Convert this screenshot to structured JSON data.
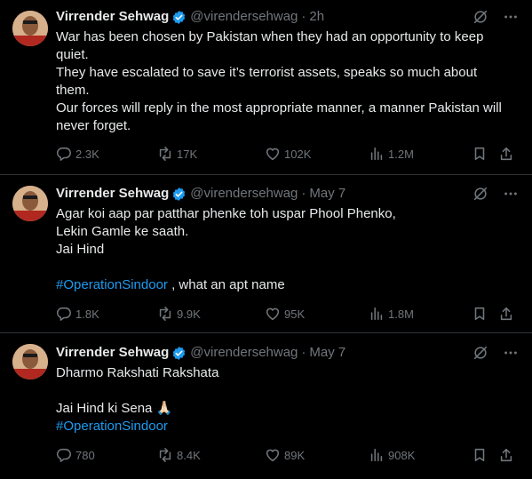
{
  "tweets": [
    {
      "author": "Virrender Sehwag",
      "handle": "@virendersehwag",
      "time": "2h",
      "lines": [
        "War has been chosen by Pakistan when they had an opportunity to keep",
        "quiet.",
        "They have escalated to save it’s terrorist assets, speaks so much about",
        "them.",
        "Our forces will reply in the most appropriate manner, a manner Pakistan will",
        "never forget."
      ],
      "replies": "2.3K",
      "reposts": "17K",
      "likes": "102K",
      "views": "1.2M"
    },
    {
      "author": "Virrender Sehwag",
      "handle": "@virendersehwag",
      "time": "May 7",
      "lines": [
        "Agar koi aap par patthar phenke toh uspar Phool Phenko,",
        "Lekin Gamle ke saath.",
        "Jai Hind",
        ""
      ],
      "hashtag": "#OperationSindoor",
      "hashtag_suffix": " , what an apt name",
      "replies": "1.8K",
      "reposts": "9.9K",
      "likes": "95K",
      "views": "1.8M"
    },
    {
      "author": "Virrender Sehwag",
      "handle": "@virendersehwag",
      "time": "May 7",
      "lines": [
        "Dharmo Rakshati Rakshata",
        "",
        "Jai Hind ki Sena 🙏🏻"
      ],
      "hashtag": "#OperationSindoor",
      "replies": "780",
      "reposts": "8.4K",
      "likes": "89K",
      "views": "908K"
    }
  ],
  "colors": {
    "background": "#000000",
    "text": "#e7e9ea",
    "muted": "#71767b",
    "link": "#1d9bf0",
    "verified": "#1d9bf0",
    "divider": "#2f3336"
  },
  "icons": {
    "verified": "verified-badge-icon",
    "grok": "grok-icon",
    "more": "more-icon",
    "reply": "reply-icon",
    "repost": "repost-icon",
    "like": "heart-icon",
    "views": "views-icon",
    "bookmark": "bookmark-icon",
    "share": "share-icon"
  }
}
